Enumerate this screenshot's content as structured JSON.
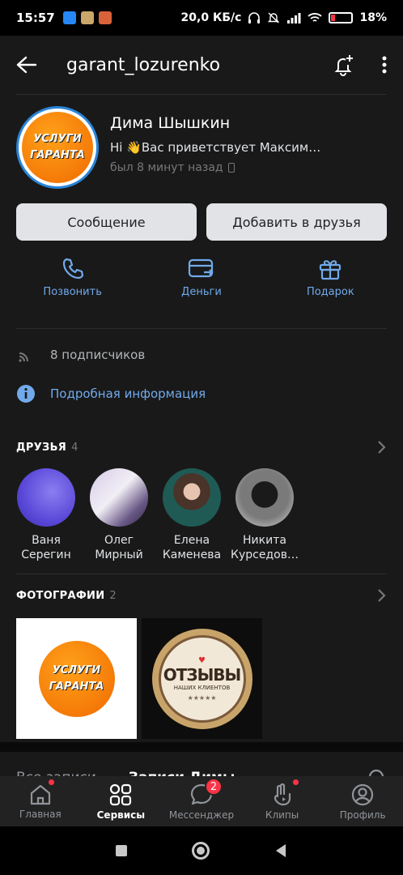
{
  "status_bar": {
    "time": "15:57",
    "network": "20,0 КБ/с",
    "battery": "18%",
    "battery_level": 0.18
  },
  "header": {
    "username": "garant_lozurenko"
  },
  "profile": {
    "name": "Дима Шышкин",
    "status": "Hi 👋Вас приветствует Максим…",
    "last_seen": "был 8 минут назад",
    "avatar_text_line1": "УСЛУГИ",
    "avatar_text_line2": "ГАРАНТА"
  },
  "actions": {
    "message": "Сообщение",
    "add_friend": "Добавить в друзья"
  },
  "quick_actions": [
    {
      "label": "Позвонить",
      "icon": "phone-icon"
    },
    {
      "label": "Деньги",
      "icon": "money-card-icon"
    },
    {
      "label": "Подарок",
      "icon": "gift-icon"
    }
  ],
  "subscribers": "8 подписчиков",
  "details_link": "Подробная информация",
  "friends": {
    "title": "ДРУЗЬЯ",
    "count": "4",
    "items": [
      {
        "first": "Ваня",
        "last": "Серегин"
      },
      {
        "first": "Олег",
        "last": "Мирный"
      },
      {
        "first": "Елена",
        "last": "Каменева"
      },
      {
        "first": "Никита",
        "last": "Курседов…"
      }
    ]
  },
  "photos": {
    "title": "ФОТОГРАФИИ",
    "count": "2",
    "photo1_line1": "УСЛУГИ",
    "photo1_line2": "ГАРАНТА",
    "photo2_line1": "ОТЗЫВЫ",
    "photo2_line2": "НАШИХ КЛИЕНТОВ"
  },
  "posts_tabs": {
    "all": "Все записи",
    "own": "Записи Димы"
  },
  "bottom_nav": [
    {
      "label": "Главная",
      "icon": "home-icon"
    },
    {
      "label": "Сервисы",
      "icon": "services-icon"
    },
    {
      "label": "Мессенджер",
      "icon": "messenger-icon",
      "badge": "2"
    },
    {
      "label": "Клипы",
      "icon": "clips-icon"
    },
    {
      "label": "Профиль",
      "icon": "profile-icon"
    }
  ],
  "colors": {
    "accent": "#71aaeb",
    "background": "#191919",
    "badge": "#ff3347",
    "button": "#e1e3e6"
  }
}
